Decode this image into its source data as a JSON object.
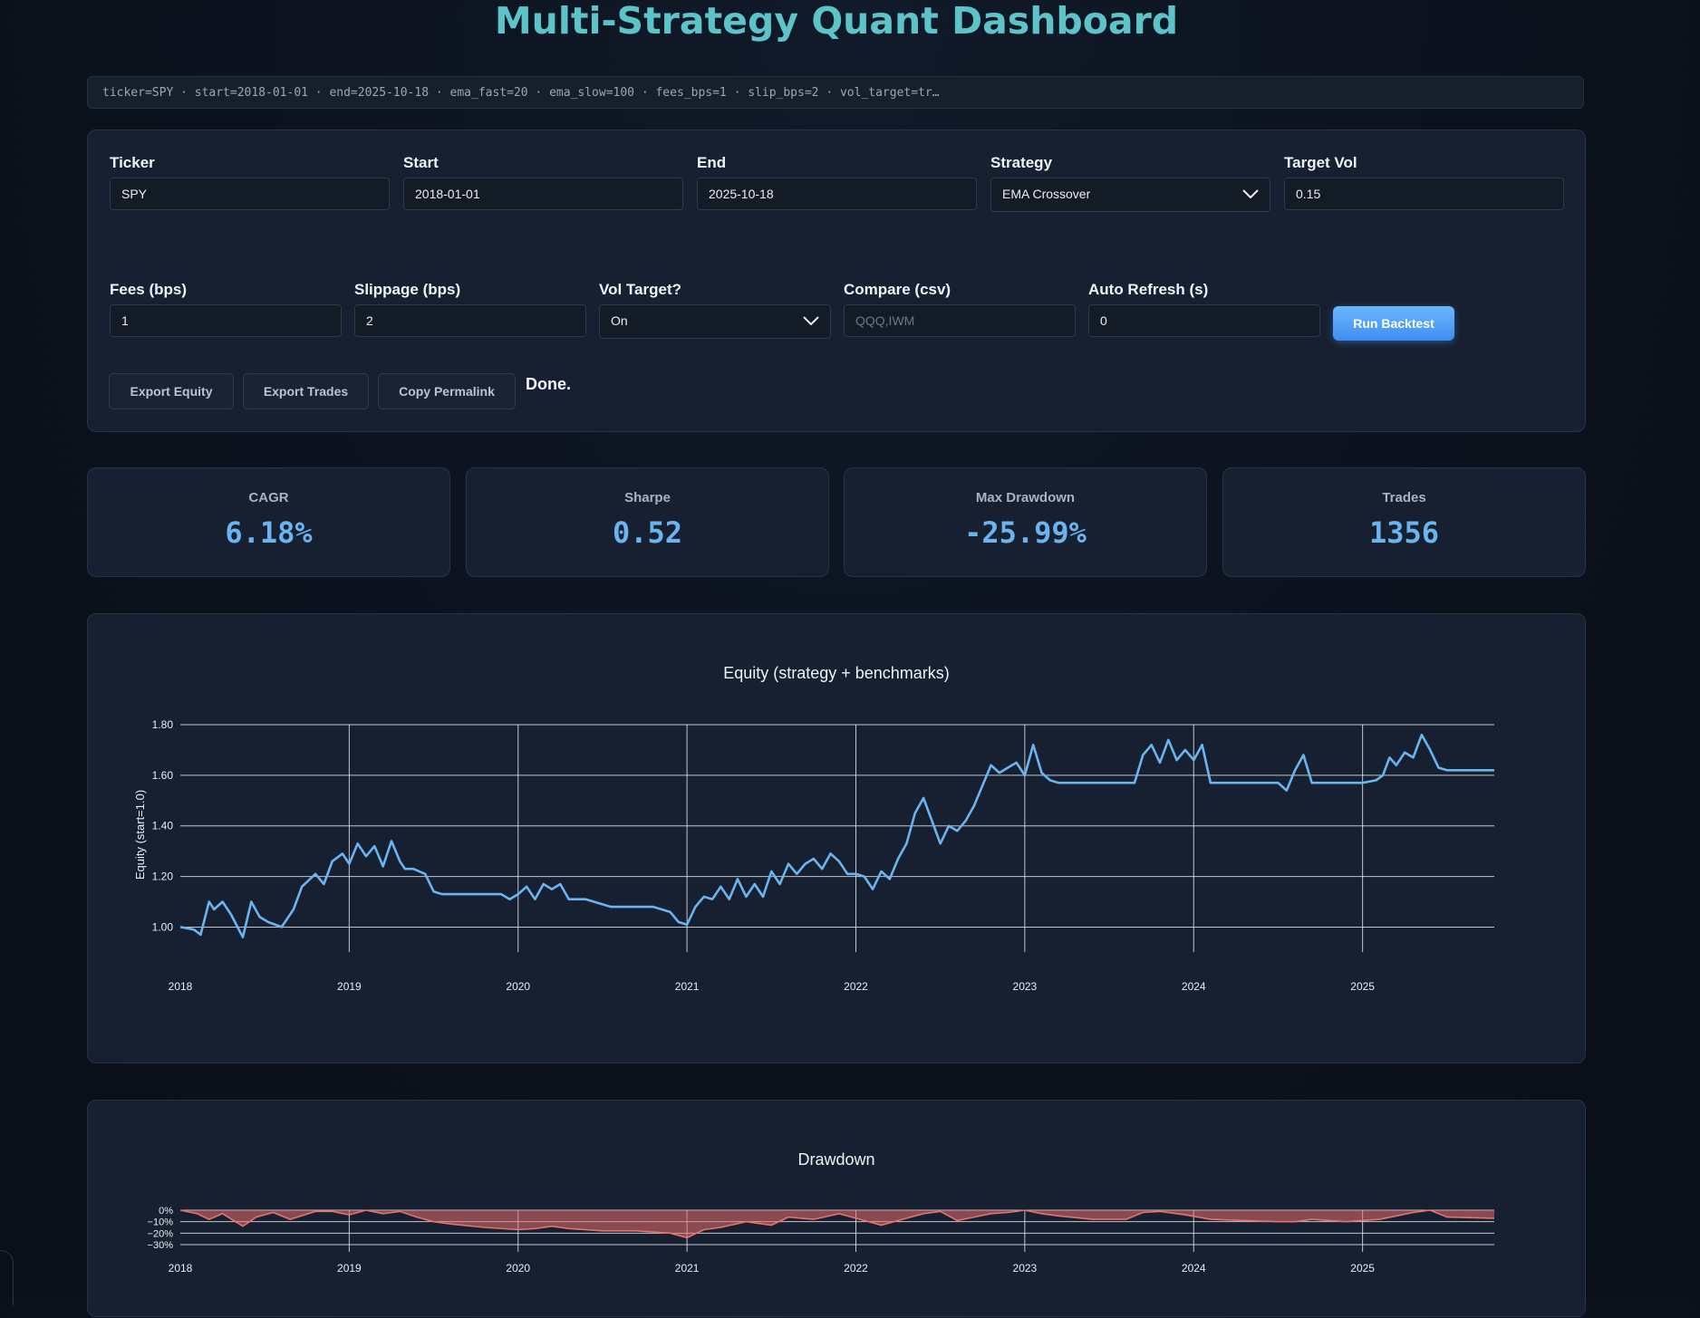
{
  "header": {
    "title": "Multi-Strategy Quant Dashboard"
  },
  "permalink": {
    "text": "ticker=SPY · start=2018-01-01 · end=2025-10-18 · ema_fast=20 · ema_slow=100 · fees_bps=1 · slip_bps=2 · vol_target=tr…"
  },
  "form": {
    "ticker": {
      "label": "Ticker",
      "value": "SPY"
    },
    "start": {
      "label": "Start",
      "value": "2018-01-01"
    },
    "end": {
      "label": "End",
      "value": "2025-10-18"
    },
    "strategy": {
      "label": "Strategy",
      "value": "EMA Crossover"
    },
    "target_vol": {
      "label": "Target Vol",
      "value": "0.15"
    },
    "fees": {
      "label": "Fees (bps)",
      "value": "1"
    },
    "slippage": {
      "label": "Slippage (bps)",
      "value": "2"
    },
    "vol_target": {
      "label": "Vol Target?",
      "value": "On"
    },
    "compare": {
      "label": "Compare (csv)",
      "value": "",
      "placeholder": "QQQ,IWM"
    },
    "auto_refresh": {
      "label": "Auto Refresh (s)",
      "value": "0"
    },
    "run_label": "Run Backtest",
    "export_equity_label": "Export Equity",
    "export_trades_label": "Export Trades",
    "copy_permalink_label": "Copy Permalink",
    "status": "Done."
  },
  "kpis": [
    {
      "label": "CAGR",
      "value": "6.18%"
    },
    {
      "label": "Sharpe",
      "value": "0.52"
    },
    {
      "label": "Max Drawdown",
      "value": "-25.99%"
    },
    {
      "label": "Trades",
      "value": "1356"
    }
  ],
  "colors": {
    "accent": "#6ab4f0",
    "title": "#5cc3c8",
    "drawdown": "#e8706e",
    "primary_button": "#4f9bf5"
  },
  "chart_data": [
    {
      "type": "line",
      "title": "Equity (strategy + benchmarks)",
      "ylabel": "Equity (start=1.0)",
      "xlabel": "",
      "ylim": [
        0.93,
        1.8
      ],
      "yticks": [
        "1.00",
        "1.20",
        "1.40",
        "1.60",
        "1.80"
      ],
      "xticks": [
        "2018",
        "2019",
        "2020",
        "2021",
        "2022",
        "2023",
        "2024",
        "2025"
      ],
      "grid": true,
      "series": [
        {
          "color": "#6ab4f0",
          "x": [
            2018.0,
            2018.08,
            2018.12,
            2018.17,
            2018.2,
            2018.25,
            2018.3,
            2018.37,
            2018.42,
            2018.47,
            2018.52,
            2018.6,
            2018.67,
            2018.72,
            2018.8,
            2018.85,
            2018.9,
            2018.96,
            2019.0,
            2019.05,
            2019.1,
            2019.15,
            2019.2,
            2019.25,
            2019.3,
            2019.33,
            2019.38,
            2019.45,
            2019.5,
            2019.55,
            2019.75,
            2019.9,
            2019.95,
            2020.0,
            2020.05,
            2020.1,
            2020.15,
            2020.2,
            2020.25,
            2020.3,
            2020.4,
            2020.55,
            2020.65,
            2020.8,
            2020.9,
            2020.95,
            2021.0,
            2021.05,
            2021.1,
            2021.15,
            2021.2,
            2021.25,
            2021.3,
            2021.35,
            2021.4,
            2021.45,
            2021.5,
            2021.55,
            2021.6,
            2021.65,
            2021.7,
            2021.75,
            2021.8,
            2021.85,
            2021.9,
            2021.95,
            2022.0,
            2022.05,
            2022.1,
            2022.15,
            2022.2,
            2022.25,
            2022.3,
            2022.35,
            2022.4,
            2022.45,
            2022.5,
            2022.55,
            2022.6,
            2022.65,
            2022.7,
            2022.75,
            2022.8,
            2022.85,
            2022.9,
            2022.95,
            2023.0,
            2023.05,
            2023.1,
            2023.15,
            2023.2,
            2023.3,
            2023.5,
            2023.65,
            2023.7,
            2023.75,
            2023.8,
            2023.85,
            2023.9,
            2023.95,
            2024.0,
            2024.05,
            2024.1,
            2024.3,
            2024.5,
            2024.55,
            2024.6,
            2024.65,
            2024.7,
            2024.75,
            2024.8,
            2025.0,
            2025.08,
            2025.12,
            2025.16,
            2025.2,
            2025.25,
            2025.3,
            2025.35,
            2025.4,
            2025.45,
            2025.5,
            2025.6,
            2025.78
          ],
          "y": [
            1.0,
            0.99,
            0.97,
            1.1,
            1.07,
            1.1,
            1.05,
            0.96,
            1.1,
            1.04,
            1.02,
            1.0,
            1.07,
            1.16,
            1.21,
            1.17,
            1.26,
            1.29,
            1.25,
            1.33,
            1.28,
            1.32,
            1.24,
            1.34,
            1.26,
            1.23,
            1.23,
            1.21,
            1.14,
            1.13,
            1.13,
            1.13,
            1.11,
            1.13,
            1.16,
            1.11,
            1.17,
            1.15,
            1.17,
            1.11,
            1.11,
            1.08,
            1.08,
            1.08,
            1.06,
            1.02,
            1.01,
            1.08,
            1.12,
            1.11,
            1.16,
            1.11,
            1.19,
            1.12,
            1.17,
            1.12,
            1.22,
            1.17,
            1.25,
            1.21,
            1.25,
            1.27,
            1.23,
            1.29,
            1.26,
            1.21,
            1.21,
            1.2,
            1.15,
            1.22,
            1.19,
            1.27,
            1.33,
            1.45,
            1.51,
            1.42,
            1.33,
            1.4,
            1.38,
            1.42,
            1.48,
            1.56,
            1.64,
            1.61,
            1.63,
            1.65,
            1.6,
            1.72,
            1.61,
            1.58,
            1.57,
            1.57,
            1.57,
            1.57,
            1.68,
            1.72,
            1.65,
            1.74,
            1.66,
            1.7,
            1.66,
            1.72,
            1.57,
            1.57,
            1.57,
            1.54,
            1.62,
            1.68,
            1.57,
            1.57,
            1.57,
            1.57,
            1.58,
            1.6,
            1.67,
            1.64,
            1.69,
            1.67,
            1.76,
            1.7,
            1.63,
            1.62,
            1.62,
            1.62
          ]
        }
      ]
    },
    {
      "type": "area",
      "title": "Drawdown",
      "ylim": [
        -30,
        0
      ],
      "yticks": [
        "0%",
        "−10%",
        "−20%",
        "−30%"
      ],
      "xticks": [
        "2018",
        "2019",
        "2020",
        "2021",
        "2022",
        "2023",
        "2024",
        "2025"
      ],
      "grid": true,
      "series": [
        {
          "color": "#e8706e",
          "x": [
            2018.0,
            2018.1,
            2018.17,
            2018.25,
            2018.37,
            2018.45,
            2018.55,
            2018.65,
            2018.8,
            2018.9,
            2019.0,
            2019.1,
            2019.2,
            2019.3,
            2019.4,
            2019.5,
            2019.6,
            2019.8,
            2020.0,
            2020.1,
            2020.2,
            2020.3,
            2020.5,
            2020.7,
            2020.9,
            2021.0,
            2021.1,
            2021.2,
            2021.35,
            2021.5,
            2021.6,
            2021.75,
            2021.9,
            2022.0,
            2022.15,
            2022.3,
            2022.4,
            2022.5,
            2022.6,
            2022.7,
            2022.8,
            2022.9,
            2023.0,
            2023.1,
            2023.2,
            2023.4,
            2023.6,
            2023.7,
            2023.8,
            2023.95,
            2024.1,
            2024.3,
            2024.5,
            2024.6,
            2024.7,
            2024.9,
            2025.1,
            2025.2,
            2025.3,
            2025.4,
            2025.5,
            2025.78
          ],
          "y": [
            0,
            -3,
            -8,
            -3,
            -14,
            -6,
            -2,
            -8,
            -1,
            -1,
            -4,
            0,
            -3,
            -1,
            -6,
            -10,
            -12,
            -15,
            -17,
            -16,
            -14,
            -16,
            -18,
            -18,
            -20,
            -24,
            -17,
            -15,
            -10,
            -13,
            -6,
            -8,
            -3,
            -7,
            -13,
            -7,
            -3,
            -1,
            -9,
            -6,
            -3,
            -2,
            0,
            -3,
            -5,
            -8,
            -8,
            -2,
            -1,
            -4,
            -8,
            -9,
            -10,
            -10,
            -8,
            -10,
            -8,
            -5,
            -2,
            0,
            -6,
            -7
          ]
        }
      ]
    }
  ]
}
